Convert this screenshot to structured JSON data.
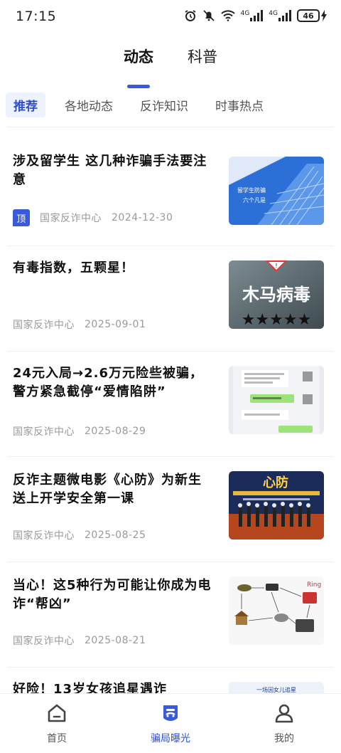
{
  "status_bar": {
    "time": "17:15",
    "battery": "46",
    "signal_1": "4G",
    "signal_2": "4G"
  },
  "top_tabs": [
    {
      "label": "动态",
      "active": true
    },
    {
      "label": "科普",
      "active": false
    }
  ],
  "sub_tabs": [
    {
      "label": "推荐",
      "active": true
    },
    {
      "label": "各地动态",
      "active": false
    },
    {
      "label": "反诈知识",
      "active": false
    },
    {
      "label": "时事热点",
      "active": false
    }
  ],
  "feed": [
    {
      "title": "涉及留学生 这几种诈骗手法要注意",
      "pinned": true,
      "badge": "顶",
      "source": "国家反诈中心",
      "date": "2024-12-30",
      "thumb_text": [
        "留学生防骗",
        "六个凡是"
      ]
    },
    {
      "title": "有毒指数，五颗星！",
      "pinned": false,
      "source": "国家反诈中心",
      "date": "2025-09-01",
      "thumb_text": [
        "木马病毒",
        "★★★★★"
      ]
    },
    {
      "title": "24元入局→2.6万元险些被骗，警方紧急截停“爱情陷阱”",
      "pinned": false,
      "source": "国家反诈中心",
      "date": "2025-08-29",
      "thumb_text": []
    },
    {
      "title": "反诈主题微电影《心防》为新生送上开学安全第一课",
      "pinned": false,
      "source": "国家反诈中心",
      "date": "2025-08-25",
      "thumb_text": [
        "心防"
      ]
    },
    {
      "title": "当心！这5种行为可能让你成为电诈“帮凶”",
      "pinned": false,
      "source": "国家反诈中心",
      "date": "2025-08-21",
      "thumb_text": [
        "Ring"
      ]
    },
    {
      "title": "好险！13岁女孩追星遇诈",
      "pinned": false,
      "source": "",
      "date": "",
      "thumb_text": [
        "一场因女儿追星"
      ]
    }
  ],
  "bottom_nav": [
    {
      "label": "首页",
      "icon": "home-icon",
      "active": false
    },
    {
      "label": "骗局曝光",
      "icon": "mask-icon",
      "active": true
    },
    {
      "label": "我的",
      "icon": "person-icon",
      "active": false
    }
  ],
  "colors": {
    "accent": "#3a5bd9",
    "meta_gray": "#999999"
  }
}
